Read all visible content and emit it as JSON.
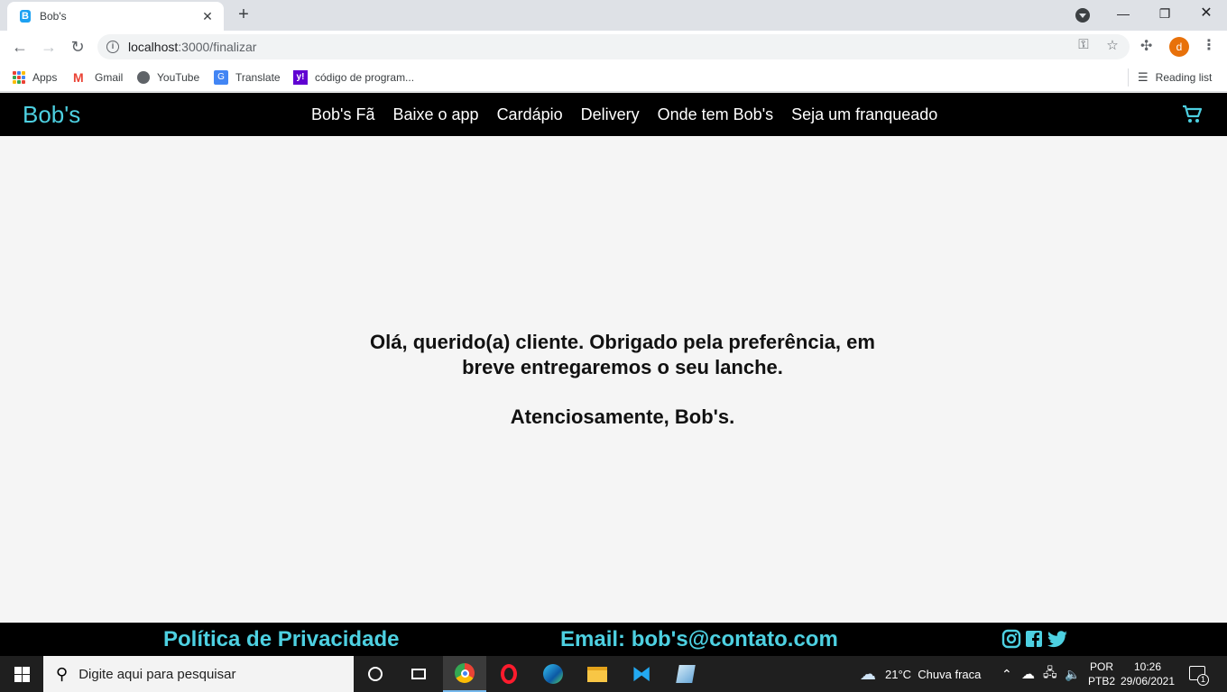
{
  "browser": {
    "tab_title": "Bob's",
    "url_host": "localhost",
    "url_rest": ":3000/finalizar",
    "profile_initial": "d",
    "bookmarks": [
      "Apps",
      "Gmail",
      "YouTube",
      "Translate",
      "código de program..."
    ],
    "reading_list": "Reading list"
  },
  "site": {
    "brand": "Bob's",
    "nav": [
      "Bob's Fã",
      "Baixe o app",
      "Cardápio",
      "Delivery",
      "Onde tem Bob's",
      "Seja um franqueado"
    ],
    "message_line1": "Olá, querido(a) cliente. Obrigado pela preferência, em",
    "message_line2": "breve entregaremos o seu lanche.",
    "signoff": "Atenciosamente, Bob's.",
    "footer_privacy": "Política de Privacidade",
    "footer_email": "Email: bob's@contato.com",
    "accent_color": "#4dd0e1",
    "social_icons": [
      "instagram-icon",
      "facebook-icon",
      "twitter-icon"
    ]
  },
  "taskbar": {
    "search_placeholder": "Digite aqui para pesquisar",
    "weather": "21°C  Chuva fraca",
    "lang_line1": "POR",
    "lang_line2": "PTB2",
    "time": "10:26",
    "date": "29/06/2021",
    "notification_count": "1"
  }
}
